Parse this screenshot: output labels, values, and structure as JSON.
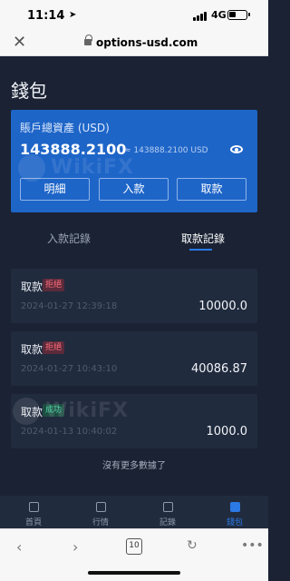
{
  "status_bar": {
    "time": "11:14",
    "network": "4G"
  },
  "browser": {
    "domain": "options-usd.com",
    "tab_count": "10"
  },
  "page": {
    "title": "錢包"
  },
  "balance_card": {
    "label": "賬戶總資產 (USD)",
    "balance": "143888.2100",
    "equivalent": "≈ 143888.2100 USD",
    "buttons": [
      "明細",
      "入款",
      "取款"
    ]
  },
  "tabs": {
    "deposit": "入款記錄",
    "withdraw": "取款記錄",
    "active": "取款記錄"
  },
  "records": [
    {
      "type": "取款",
      "status": "拒絕",
      "status_kind": "reject",
      "date": "2024-01-27 12:39:18",
      "amount": "10000.0"
    },
    {
      "type": "取款",
      "status": "拒絕",
      "status_kind": "reject",
      "date": "2024-01-27 10:43:10",
      "amount": "40086.87"
    },
    {
      "type": "取款",
      "status": "成功",
      "status_kind": "ok",
      "date": "2024-01-13 10:40:02",
      "amount": "1000.0"
    }
  ],
  "no_more_text": "沒有更多數據了",
  "bottom_nav": [
    {
      "label": "首頁",
      "icon": "home-icon"
    },
    {
      "label": "行情",
      "icon": "chart-icon"
    },
    {
      "label": "記錄",
      "icon": "record-icon"
    },
    {
      "label": "錢包",
      "icon": "wallet-icon",
      "active": true
    }
  ],
  "watermark": "WikiFX",
  "colors": {
    "accent": "#2b79e5",
    "card": "#1e65c8",
    "reject": "#ff6b7a",
    "success": "#42d39d"
  }
}
